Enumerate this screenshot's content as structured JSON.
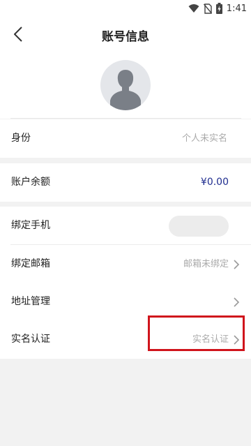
{
  "status_bar": {
    "time": "1:41"
  },
  "header": {
    "title": "账号信息"
  },
  "profile": {
    "identity_label": "身份",
    "identity_value": "个人未实名"
  },
  "account": {
    "balance_label": "账户余额",
    "balance_value": "¥0.00"
  },
  "bindings": {
    "phone_label": "绑定手机",
    "email_label": "绑定邮箱",
    "email_value": "邮箱未绑定",
    "address_label": "地址管理",
    "realname_label": "实名认证",
    "realname_value": "实名认证"
  },
  "colors": {
    "accent_balance": "#1f2d8f",
    "highlight": "#d0141c"
  }
}
